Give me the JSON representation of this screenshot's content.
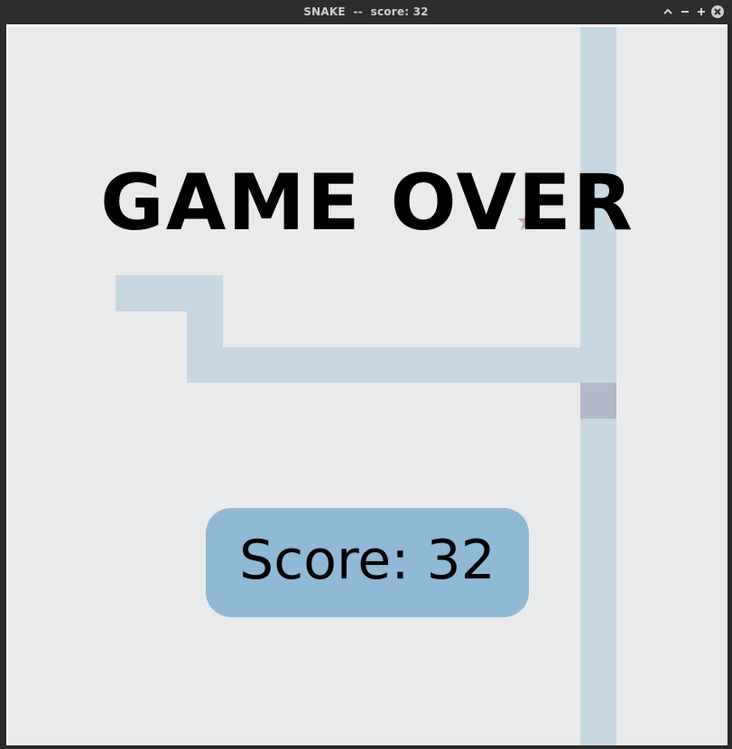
{
  "window": {
    "title": "SNAKE  --  score: 32",
    "controls": {
      "up_icon": "chevron-up-icon",
      "minimize_icon": "minimize-icon",
      "maximize_icon": "maximize-icon",
      "close_icon": "close-icon"
    }
  },
  "game": {
    "status_text": "GAME OVER",
    "score_label": "Score: 32",
    "score": 32,
    "food_icon": "star-icon",
    "colors": {
      "background": "#e9eaec",
      "snake_body": "#c7d8e3",
      "snake_head": "#b2bacb",
      "score_box": "#8fb9d5",
      "food": "#c9a3a6"
    }
  }
}
